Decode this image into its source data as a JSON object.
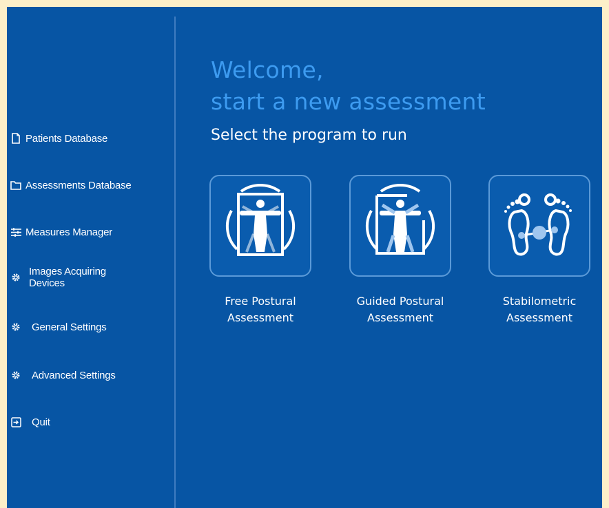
{
  "colors": {
    "frame": "#fcefc9",
    "background": "#0755a4",
    "accent": "#3d9bf0",
    "divider": "#3f7cc0",
    "card_border": "#5b9ad8"
  },
  "sidebar": {
    "items": [
      {
        "label": "Patients Database",
        "icon": "file-icon"
      },
      {
        "label": "Assessments Database",
        "icon": "folder-icon"
      },
      {
        "label": "Measures Manager",
        "icon": "sliders-icon"
      },
      {
        "label": "Images Acquiring Devices",
        "label_line1": "Images Acquiring",
        "label_line2": "Devices",
        "icon": "gear-icon"
      },
      {
        "label": "General Settings",
        "icon": "gear-icon"
      },
      {
        "label": "Advanced Settings",
        "icon": "gear-icon"
      },
      {
        "label": "Quit",
        "icon": "exit-icon"
      }
    ]
  },
  "main": {
    "welcome_line1": "Welcome,",
    "welcome_line2": "start a new assessment",
    "subtitle": "Select the program to run",
    "programs": [
      {
        "label_line1": "Free Postural",
        "label_line2": "Assessment",
        "icon": "vitruvian-man-icon"
      },
      {
        "label_line1": "Guided Postural",
        "label_line2": "Assessment",
        "icon": "vitruvian-man-guided-icon"
      },
      {
        "label_line1": "Stabilometric",
        "label_line2": "Assessment",
        "icon": "feet-balance-icon"
      }
    ]
  }
}
